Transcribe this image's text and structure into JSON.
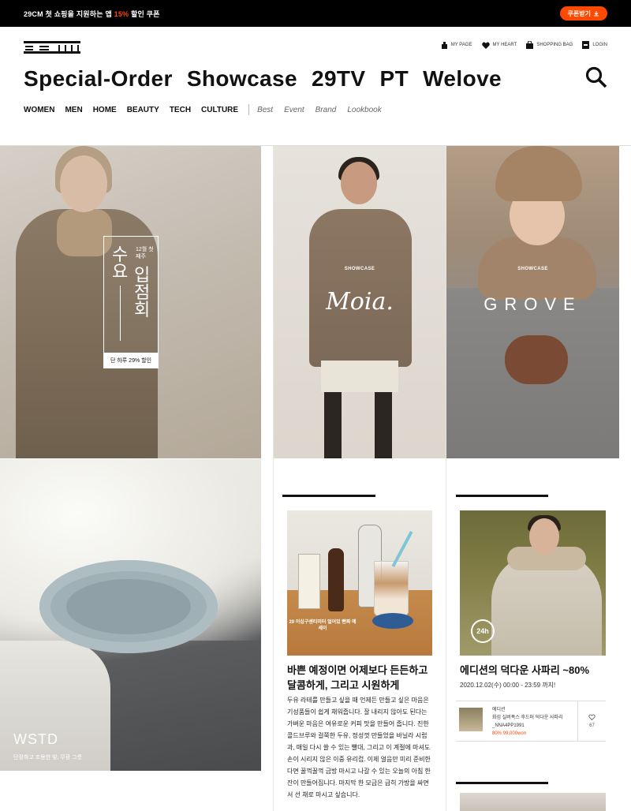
{
  "topbar": {
    "promo_prefix": "29CM 첫 쇼핑을 지원하는 앱 ",
    "promo_accent": "15%",
    "promo_suffix": " 할인 쿠폰",
    "coupon_button": "쿠폰받기",
    "accent_color": "#ff4800"
  },
  "header": {
    "logo": "29CM",
    "utility": [
      {
        "label": "MY PAGE",
        "icon": "user-icon"
      },
      {
        "label": "MY HEART",
        "icon": "heart-icon"
      },
      {
        "label": "SHOPPING BAG",
        "icon": "bag-icon"
      },
      {
        "label": "LOGIN",
        "icon": "login-icon"
      }
    ],
    "main_nav": [
      "Special-Order",
      "Showcase",
      "29TV",
      "PT",
      "Welove"
    ],
    "categories": [
      "WOMEN",
      "MEN",
      "HOME",
      "BEAUTY",
      "TECH",
      "CULTURE"
    ],
    "sub_links": [
      "Best",
      "Event",
      "Brand",
      "Lookbook"
    ]
  },
  "tiles": {
    "wednesday": {
      "title_left": "수요",
      "title_right": "입점회",
      "week": "12월 첫째주",
      "badge": "단 하루 29% 할인"
    },
    "moia": {
      "label": "SHOWCASE",
      "brand": "Moia."
    },
    "grove": {
      "label": "SHOWCASE",
      "brand": "GROVE"
    },
    "wstd": {
      "title": "WSTD",
      "subtitle": "단정하고 조용한 빛, 무광 그릇"
    }
  },
  "articles": [
    {
      "image_caption": "29 이십구센티미터 얼어있 빤짜 예세이",
      "title": "바쁜 예정이면 어제보다 든든하고 달콤하게, 그리고 시원하게",
      "body": "두유 라테를 만들고 싶을 때 언제든 만들고 싶은 마음은 기성품들이 쉽게 채워줍니다. 잘 내리지 않아도 된다는 가벼운 마음은 여유로운 커피 맛을 만들어 줍니다. 진한 콜드브루와 걸쭉한 두유, 정성껏 만들었을 바닐라 시럽과, 매일 다시 쓸 수 있는 빨대, 그리고 이 계절에 마셔도 손이 시리지 않은 이중 유리컵. 이제 얼음만 미리 준비한다면 꿀꺽꿀꺽 금방 마시고 나갈 수 있는 오늘의 아침 한 잔이 만들어집니다. 마지막 한 모금은 급히 가방을 싸면서 선 채로 마시고 싶습니다."
    },
    {
      "clock": "24h",
      "title": "에디션의 덕다운 사파리 ~80%",
      "period": "2020.12.02(수) 00:00 - 23:59 까지!",
      "product": {
        "brand": "에디션",
        "name": "화섬 실버폭스 후드퍼 덕다운 사파리 _NNA4PP1991",
        "price": "80% 99,000won",
        "likes": "67"
      }
    }
  ]
}
